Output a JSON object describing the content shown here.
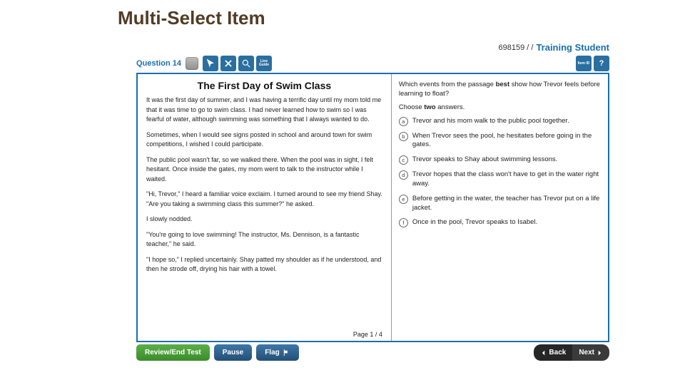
{
  "slide_title": "Multi-Select Item",
  "header": {
    "id": "698159 / /",
    "brand": "Training Student"
  },
  "toolbar": {
    "question_label": "Question 14",
    "line_guide_a": "Line",
    "line_guide_b": "Guide",
    "item_id": "Item ID",
    "help": "?"
  },
  "passage": {
    "title": "The First Day of Swim Class",
    "paragraphs": [
      "It was the first day of summer, and I was having a terrific day until my mom told me that it was time to go to swim class. I had never learned how to swim so I was fearful of water, although swimming was something that I always wanted to do.",
      "Sometimes, when I would see signs posted in school and around town for swim competitions, I wished I could participate.",
      "The public pool wasn't far, so we walked there. When the pool was in sight, I felt hesitant. Once inside the gates, my mom went to talk to the instructor while I waited.",
      "\"Hi, Trevor,\" I heard a familiar voice exclaim. I turned around to see my friend Shay. \"Are you taking a swimming class this summer?\" he asked.",
      "I slowly nodded.",
      "\"You're going to love swimming! The instructor, Ms. Dennison, is a fantastic teacher,\" he said.",
      "\"I hope so,\" I replied uncertainly. Shay patted my shoulder as if he understood, and then he strode off, drying his hair with a towel."
    ],
    "page_indicator": "Page 1 / 4"
  },
  "question": {
    "stem_pre": "Which events from the passage ",
    "stem_bold": "best",
    "stem_post": " show how Trevor feels before learning to float?",
    "instr_pre": "Choose ",
    "instr_bold": "two",
    "instr_post": " answers.",
    "options": [
      {
        "letter": "a",
        "text": "Trevor and his mom walk to the public pool together."
      },
      {
        "letter": "b",
        "text": "When Trevor sees the pool, he hesitates before going in the gates."
      },
      {
        "letter": "c",
        "text": "Trevor speaks to Shay about swimming lessons."
      },
      {
        "letter": "d",
        "text": "Trevor hopes that the class won't have to get in the water right away."
      },
      {
        "letter": "e",
        "text": "Before getting in the water, the teacher has Trevor put on a life jacket."
      },
      {
        "letter": "f",
        "text": "Once in the pool, Trevor speaks to Isabel."
      }
    ]
  },
  "bottom": {
    "review": "Review/End Test",
    "pause": "Pause",
    "flag": "Flag",
    "back": "Back",
    "next": "Next"
  }
}
